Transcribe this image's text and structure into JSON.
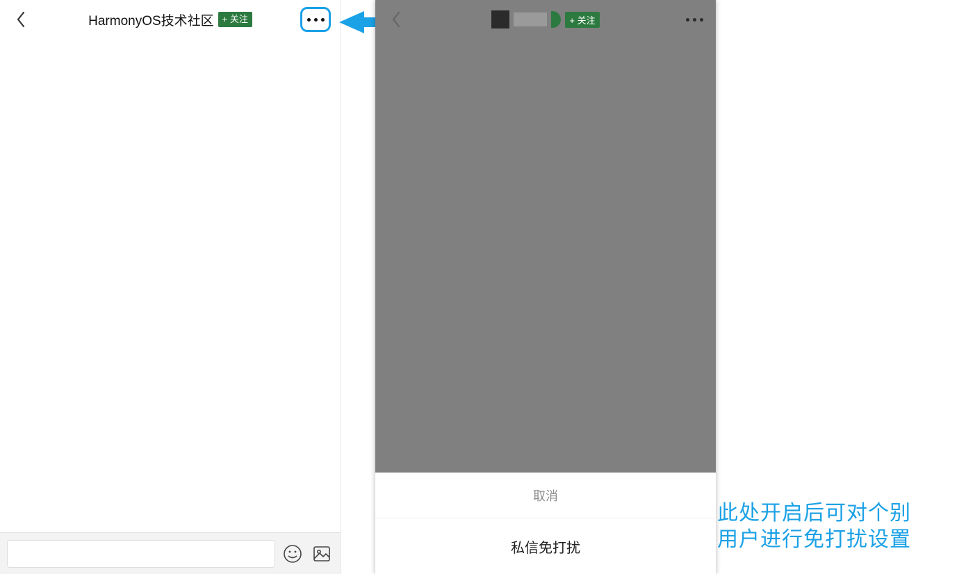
{
  "colors": {
    "accent_green": "#2c7a3f",
    "highlight_blue": "#1ba1e6"
  },
  "left": {
    "title": "HarmonyOS技术社区",
    "follow_label": "+ 关注",
    "icons": {
      "back": "chevron-left-icon",
      "more": "ellipsis-icon",
      "emoji": "smile-icon",
      "image": "image-icon"
    },
    "input_placeholder": ""
  },
  "right": {
    "follow_label": "+ 关注",
    "sheet": {
      "cancel_label": "取消",
      "option_label": "私信免打扰"
    }
  },
  "annotation": {
    "line1": "此处开启后可对个别",
    "line2": "用户进行免打扰设置"
  }
}
